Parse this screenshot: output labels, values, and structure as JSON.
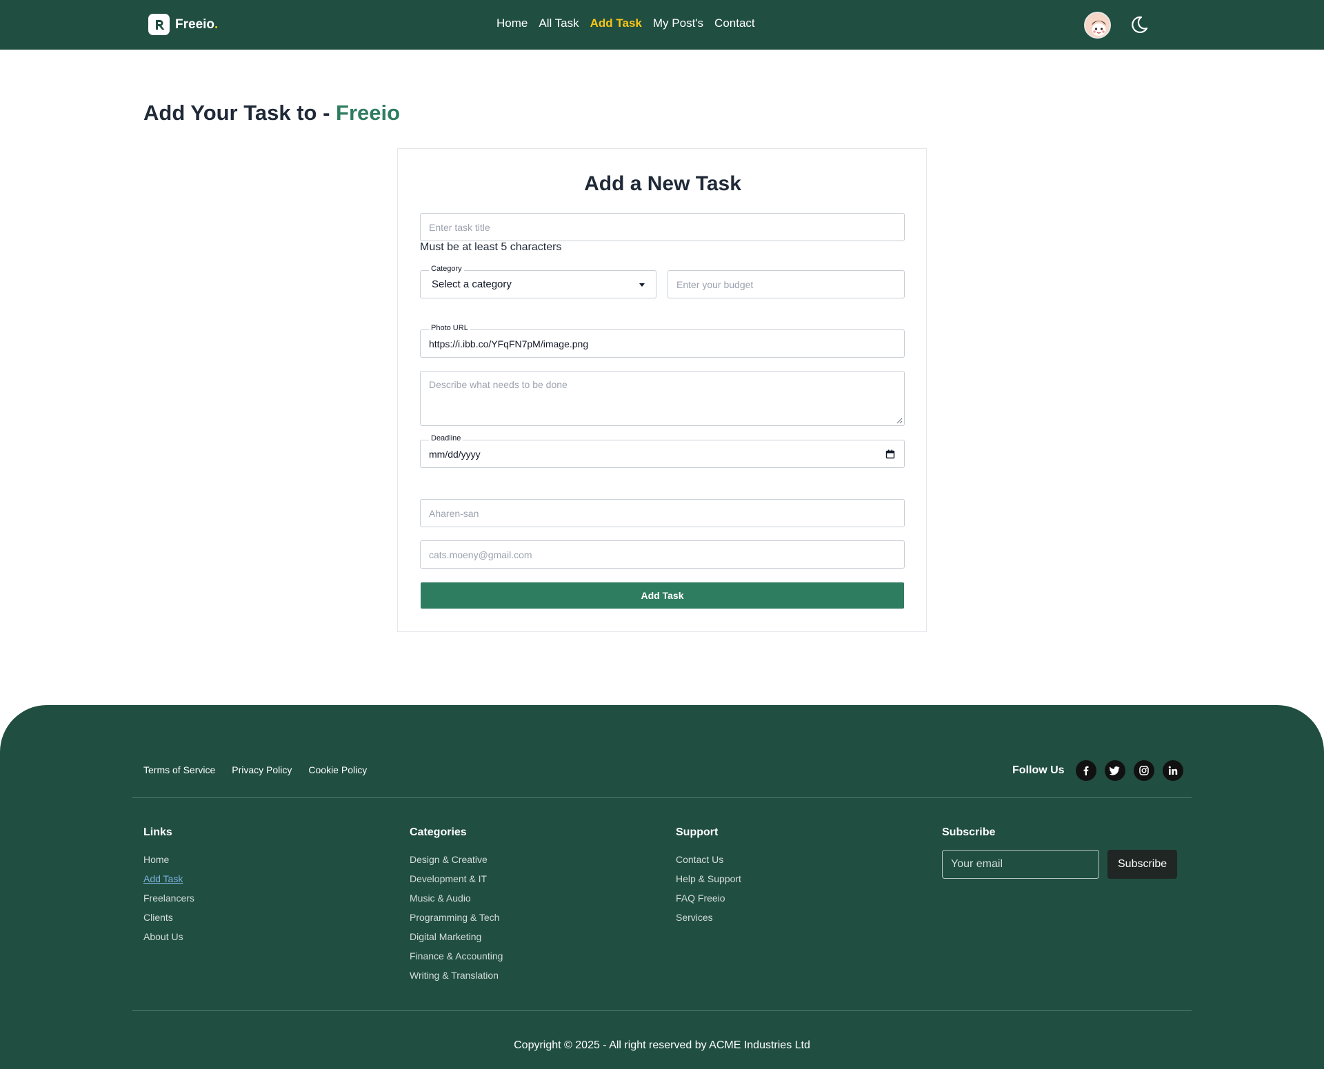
{
  "brand": {
    "name": "Freeio",
    "dot": "."
  },
  "nav": {
    "items": [
      {
        "label": "Home"
      },
      {
        "label": "All Task"
      },
      {
        "label": "Add Task"
      },
      {
        "label": "My Post's"
      },
      {
        "label": "Contact"
      }
    ],
    "active_index": 2
  },
  "heading": {
    "prefix": "Add Your Task to - ",
    "accent": "Freeio"
  },
  "form": {
    "title": "Add a New Task",
    "task_title_placeholder": "Enter task title",
    "hint": "Must be at least 5 characters",
    "category_legend": "Category",
    "category_value": "Select a category",
    "budget_placeholder": "Enter your budget",
    "photo_legend": "Photo URL",
    "photo_value": "https://i.ibb.co/YFqFN7pM/image.png",
    "description_placeholder": "Describe what needs to be done",
    "deadline_legend": "Deadline",
    "deadline_value": "mm/dd/yyyy",
    "name_value": "Aharen-san",
    "email_value": "cats.moeny@gmail.com",
    "submit_label": "Add Task"
  },
  "footer": {
    "legal": [
      "Terms of Service",
      "Privacy Policy",
      "Cookie Policy"
    ],
    "follow_label": "Follow Us",
    "socials": [
      "facebook-icon",
      "twitter-icon",
      "instagram-icon",
      "linkedin-icon"
    ],
    "columns": {
      "links": {
        "title": "Links",
        "items": [
          "Home",
          "Add Task",
          "Freelancers",
          "Clients",
          "About Us"
        ]
      },
      "categories": {
        "title": "Categories",
        "items": [
          "Design & Creative",
          "Development & IT",
          "Music & Audio",
          "Programming & Tech",
          "Digital Marketing",
          "Finance & Accounting",
          "Writing & Translation"
        ]
      },
      "support": {
        "title": "Support",
        "items": [
          "Contact Us",
          "Help & Support",
          "FAQ Freeio",
          "Services"
        ]
      },
      "subscribe": {
        "title": "Subscribe",
        "email_placeholder": "Your email",
        "button_label": "Subscribe"
      }
    },
    "copyright": "Copyright © 2025 - All right reserved by ACME Industries Ltd"
  },
  "colors": {
    "primary": "#204e40",
    "accent": "#2f7d61",
    "highlight": "#f5c518"
  }
}
